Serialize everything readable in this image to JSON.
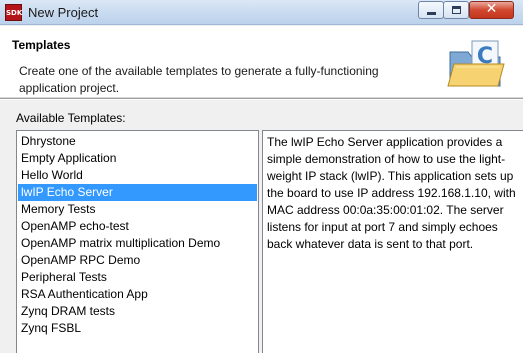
{
  "window": {
    "icon_text": "SDK",
    "title": "New Project",
    "close_glyph": "✕"
  },
  "banner": {
    "title": "Templates",
    "description": "Create one of the available templates to generate a fully-functioning application project.",
    "icon": "new-project-wizard-icon",
    "icon_letter": "C"
  },
  "templates": {
    "label": "Available Templates:",
    "selected": "lwIP Echo Server",
    "items": [
      {
        "label": "Dhrystone"
      },
      {
        "label": "Empty Application"
      },
      {
        "label": "Hello World"
      },
      {
        "label": "lwIP Echo Server"
      },
      {
        "label": "Memory Tests"
      },
      {
        "label": "OpenAMP echo-test"
      },
      {
        "label": "OpenAMP matrix multiplication Demo"
      },
      {
        "label": "OpenAMP RPC Demo"
      },
      {
        "label": "Peripheral Tests"
      },
      {
        "label": "RSA Authentication App"
      },
      {
        "label": "Zynq DRAM tests"
      },
      {
        "label": "Zynq FSBL"
      }
    ]
  },
  "description": {
    "text": "The lwIP Echo Server application provides a simple demonstration of how to use the light-weight IP stack (lwIP). This application sets up the board to use IP address 192.168.1.10, with MAC address 00:0a:35:00:01:02. The server listens for input at port 7 and simply echoes back whatever data is sent to that port."
  },
  "colors": {
    "selection": "#3399ff",
    "sdk_icon": "#b4141a"
  }
}
